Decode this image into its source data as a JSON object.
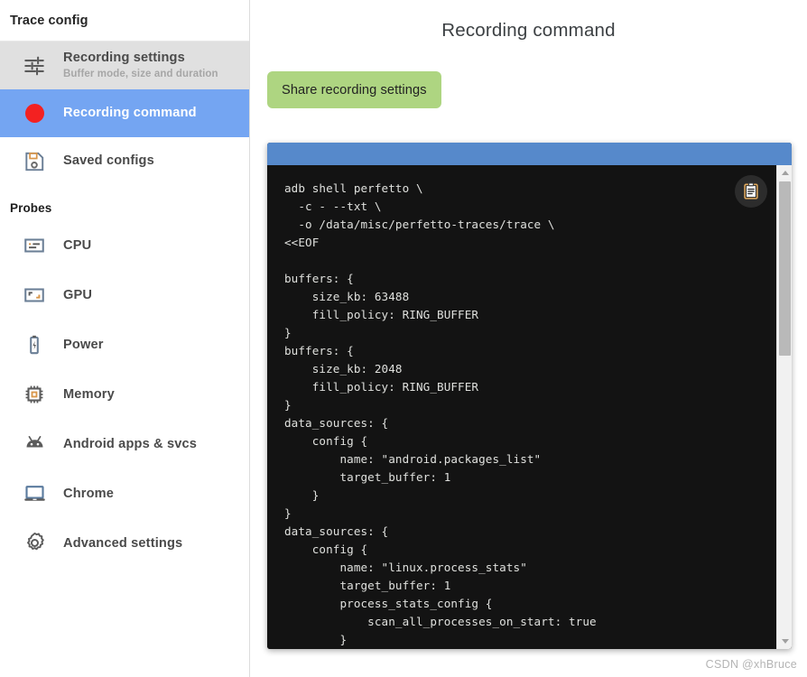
{
  "sidebar": {
    "header_title": "Trace config",
    "nav_items": [
      {
        "id": "recording-settings",
        "title": "Recording settings",
        "subtitle": "Buffer mode, size and duration",
        "icon": "tune-sliders-icon",
        "state": "hovered"
      },
      {
        "id": "recording-command",
        "title": "Recording command",
        "subtitle": "",
        "icon": "record-dot-icon",
        "state": "selected"
      },
      {
        "id": "saved-configs",
        "title": "Saved configs",
        "subtitle": "",
        "icon": "save-floppy-icon",
        "state": "normal"
      }
    ],
    "probes_label": "Probes",
    "probes": [
      {
        "id": "cpu",
        "label": "CPU",
        "icon": "cpu-icon"
      },
      {
        "id": "gpu",
        "label": "GPU",
        "icon": "gpu-icon"
      },
      {
        "id": "power",
        "label": "Power",
        "icon": "battery-icon"
      },
      {
        "id": "memory",
        "label": "Memory",
        "icon": "memory-chip-icon"
      },
      {
        "id": "android-apps",
        "label": "Android apps & svcs",
        "icon": "android-icon"
      },
      {
        "id": "chrome",
        "label": "Chrome",
        "icon": "laptop-icon"
      },
      {
        "id": "advanced",
        "label": "Advanced settings",
        "icon": "gear-icon"
      }
    ]
  },
  "main": {
    "page_title": "Recording command",
    "share_button_label": "Share recording settings",
    "copy_button_icon": "clipboard-copy-icon",
    "code": "adb shell perfetto \\\n  -c - --txt \\\n  -o /data/misc/perfetto-traces/trace \\\n<<EOF\n\nbuffers: {\n    size_kb: 63488\n    fill_policy: RING_BUFFER\n}\nbuffers: {\n    size_kb: 2048\n    fill_policy: RING_BUFFER\n}\ndata_sources: {\n    config {\n        name: \"android.packages_list\"\n        target_buffer: 1\n    }\n}\ndata_sources: {\n    config {\n        name: \"linux.process_stats\"\n        target_buffer: 1\n        process_stats_config {\n            scan_all_processes_on_start: true\n        }"
  },
  "watermark": "CSDN @xhBruce",
  "colors": {
    "selection_blue": "#74a5f2",
    "topbar_blue": "#5689cb",
    "share_green": "#aed581",
    "record_red": "#f32121",
    "code_background": "#131313",
    "hover_grey": "#e0e0e0"
  }
}
